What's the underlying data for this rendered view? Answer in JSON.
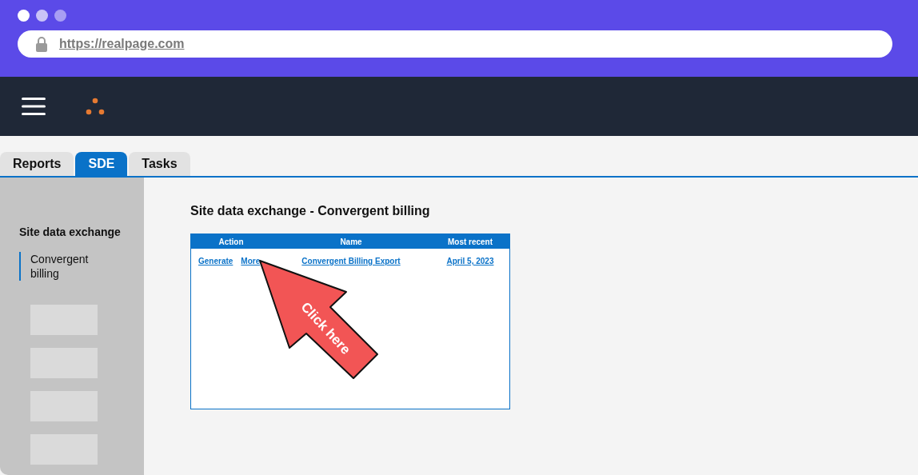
{
  "browser": {
    "url": "https://realpage.com"
  },
  "tabs": [
    {
      "label": "Reports",
      "selected": false
    },
    {
      "label": "SDE",
      "selected": true
    },
    {
      "label": "Tasks",
      "selected": false
    }
  ],
  "sidebar": {
    "heading": "Site data exchange",
    "items": [
      {
        "label": "Convergent billing",
        "selected": true
      }
    ]
  },
  "page": {
    "title": "Site data exchange - Convergent billing"
  },
  "table": {
    "columns": [
      "Action",
      "Name",
      "Most recent"
    ],
    "rows": [
      {
        "actions": [
          "Generate",
          "More"
        ],
        "name": "Convergent Billing Export",
        "most_recent": "April 5, 2023"
      }
    ]
  },
  "callout": {
    "text": "Click here"
  }
}
